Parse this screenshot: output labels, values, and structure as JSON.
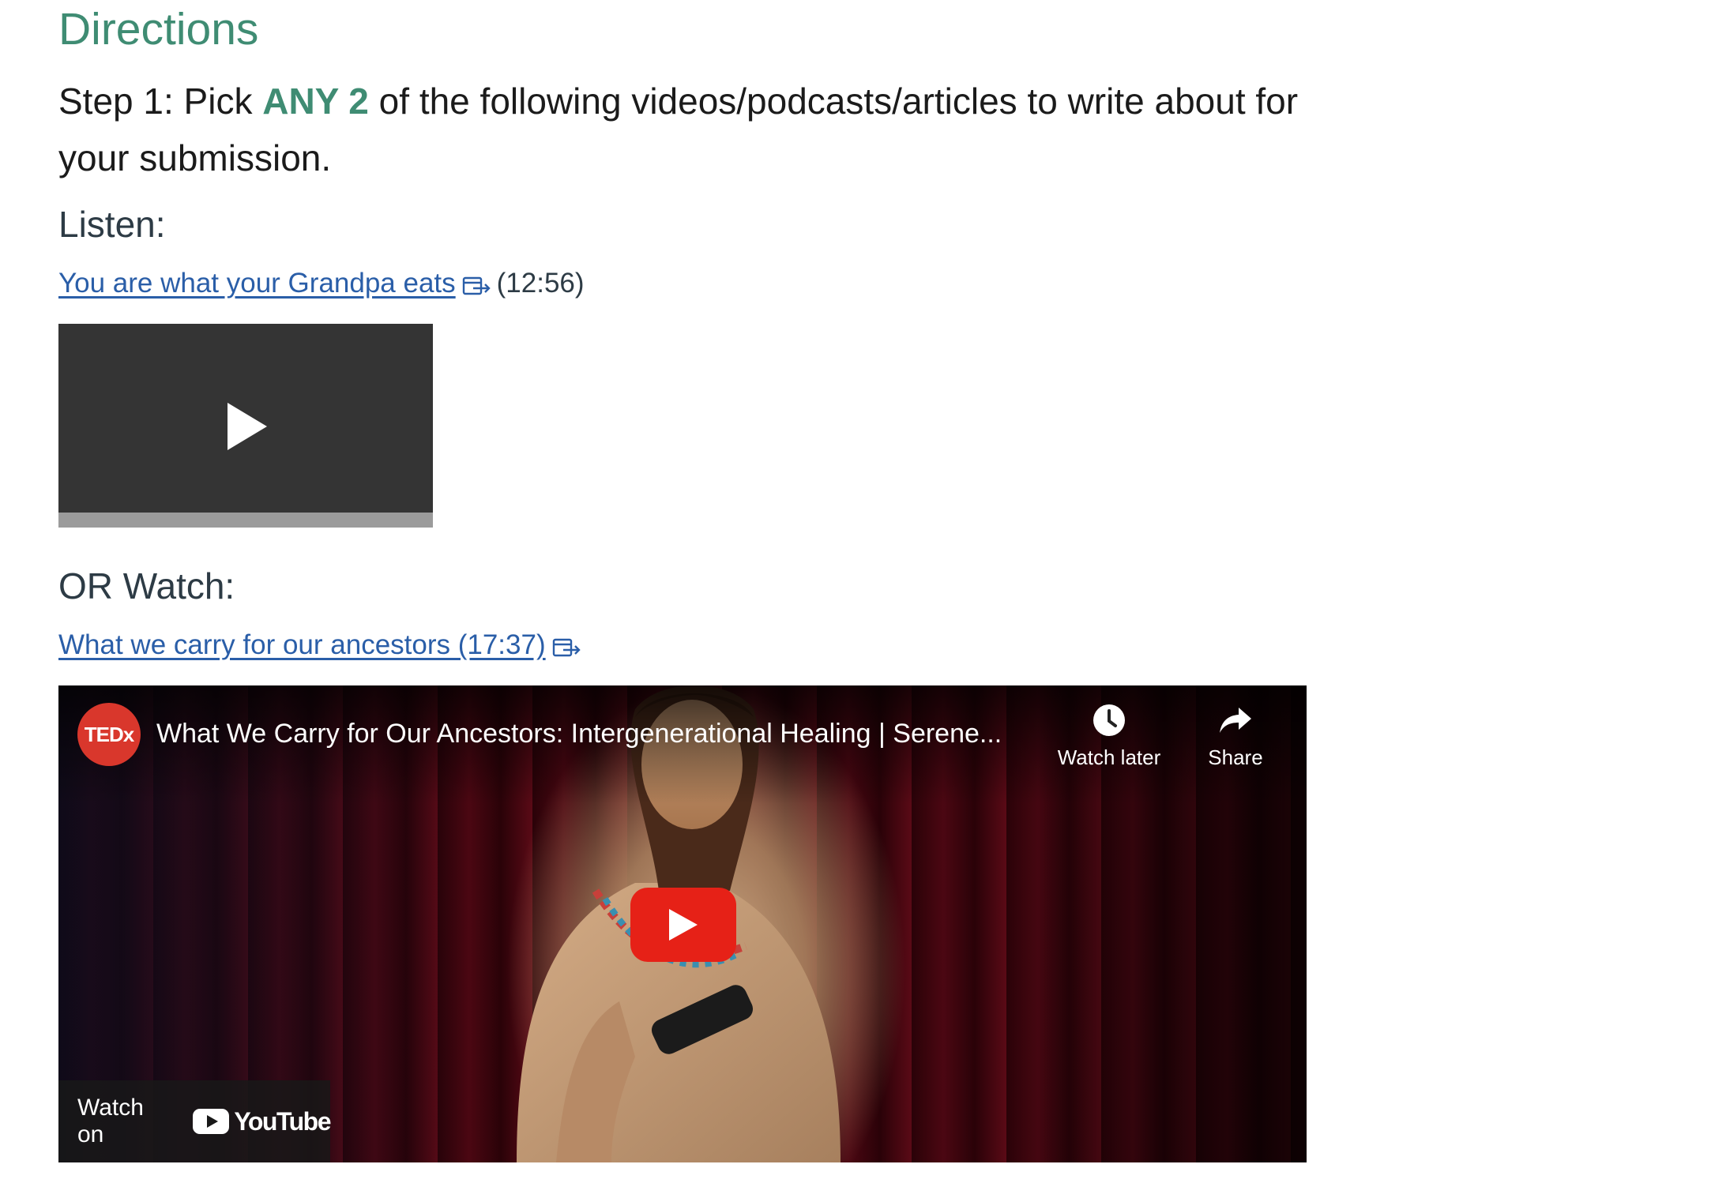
{
  "heading": "Directions",
  "step": {
    "prefix": "Step 1: Pick ",
    "accent": "ANY 2",
    "suffix": " of the following videos/podcasts/articles to write about for your submission."
  },
  "listen": {
    "label": "Listen:",
    "link_text": "You are what your Grandpa eats",
    "duration": "(12:56)",
    "player": {
      "progress": 0
    }
  },
  "watch": {
    "label": "OR Watch:",
    "link_text": "What we carry for our ancestors (17:37)"
  },
  "video": {
    "channel_logo": "TEDx",
    "title": "What We Carry for Our Ancestors: Intergenerational Healing | Serene...",
    "watch_later": "Watch later",
    "share": "Share",
    "watch_on": "Watch on",
    "platform": "YouTube"
  },
  "icons": {
    "external_link": "external-link-icon",
    "play": "play-icon",
    "clock": "clock-icon",
    "share": "share-arrow-icon"
  },
  "colors": {
    "accent": "#3f8c73",
    "link": "#2a5ea8",
    "player_bg": "#343434",
    "youtube_red": "#e62117"
  }
}
